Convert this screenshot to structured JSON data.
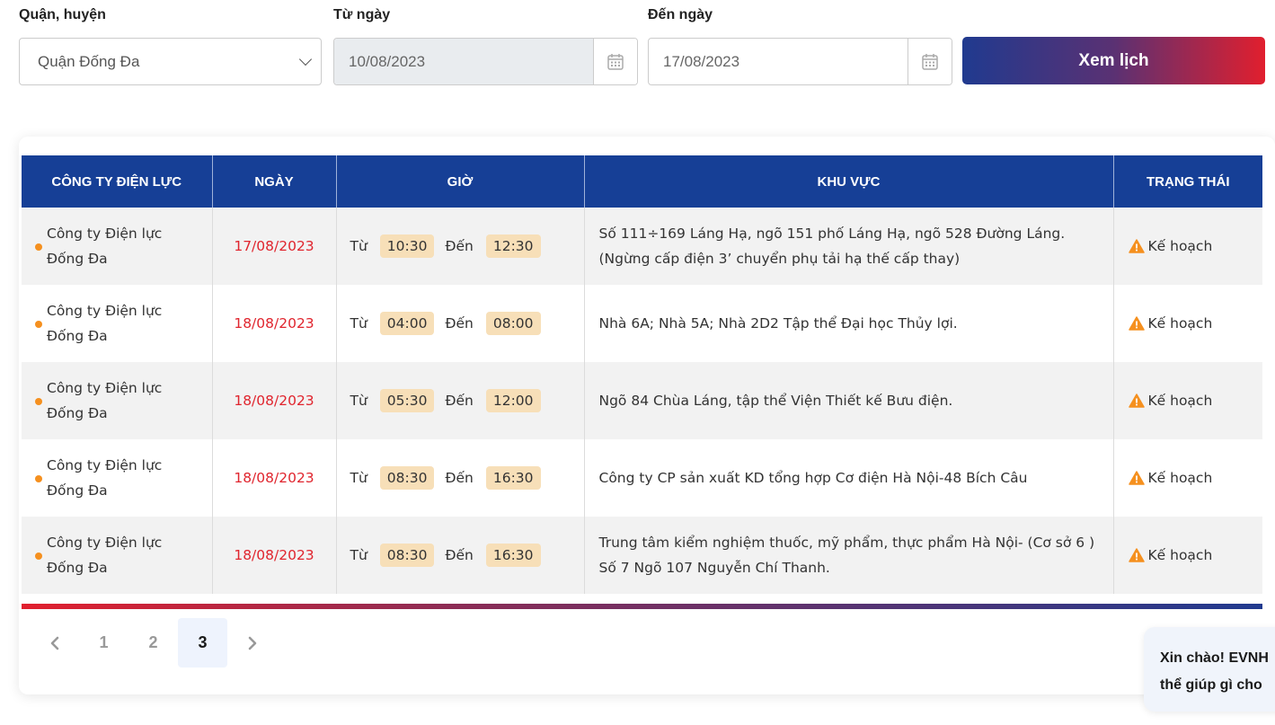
{
  "filters": {
    "district_label": "Quận, huyện",
    "district_value": "Quận Đống Đa",
    "from_label": "Từ ngày",
    "from_value": "10/08/2023",
    "to_label": "Đến ngày",
    "to_value": "17/08/2023",
    "view_button": "Xem lịch"
  },
  "table": {
    "headers": [
      "CÔNG TY ĐIỆN LỰC",
      "NGÀY",
      "GIỜ",
      "KHU VỰC",
      "TRẠNG THÁI"
    ],
    "from_word": "Từ",
    "to_word": "Đến",
    "rows": [
      {
        "company_line1": "Công ty Điện lực",
        "company_line2": "Đống Đa",
        "date": "17/08/2023",
        "start": "10:30",
        "end": "12:30",
        "area_line1": "Số 111÷169 Láng Hạ, ngõ 151 phố Láng Hạ, ngõ 528 Đường Láng.",
        "area_line2": "(Ngừng cấp điện 3’ chuyển phụ tải hạ thế cấp thay)",
        "status": "Kế hoạch"
      },
      {
        "company_line1": "Công ty Điện lực",
        "company_line2": "Đống Đa",
        "date": "18/08/2023",
        "start": "04:00",
        "end": "08:00",
        "area_line1": "Nhà 6A; Nhà 5A; Nhà 2D2 Tập thể Đại học Thủy lợi.",
        "area_line2": "",
        "status": "Kế hoạch"
      },
      {
        "company_line1": "Công ty Điện lực",
        "company_line2": "Đống Đa",
        "date": "18/08/2023",
        "start": "05:30",
        "end": "12:00",
        "area_line1": "Ngõ 84 Chùa Láng, tập thể Viện Thiết kế Bưu điện.",
        "area_line2": "",
        "status": "Kế hoạch"
      },
      {
        "company_line1": "Công ty Điện lực",
        "company_line2": "Đống Đa",
        "date": "18/08/2023",
        "start": "08:30",
        "end": "16:30",
        "area_line1": "Công ty CP sản xuất KD tổng hợp Cơ điện Hà Nội-48 Bích Câu",
        "area_line2": "",
        "status": "Kế hoạch"
      },
      {
        "company_line1": "Công ty Điện lực",
        "company_line2": "Đống Đa",
        "date": "18/08/2023",
        "start": "08:30",
        "end": "16:30",
        "area_line1": "Trung tâm kiểm nghiệm thuốc, mỹ phẩm, thực phẩm Hà Nội- (Cơ sở 6 )",
        "area_line2": "Số 7 Ngõ 107 Nguyễn Chí Thanh.",
        "status": "Kế hoạch"
      }
    ]
  },
  "pagination": {
    "pages": [
      "1",
      "2",
      "3"
    ],
    "current": "3"
  },
  "chat": {
    "line1": "Xin chào! EVNH",
    "line2": "thể giúp gì cho"
  },
  "colors": {
    "header_blue": "#163f96",
    "date_red": "#e0252e",
    "dot_orange": "#f5901f",
    "chip_bg": "#f7dfb8"
  }
}
